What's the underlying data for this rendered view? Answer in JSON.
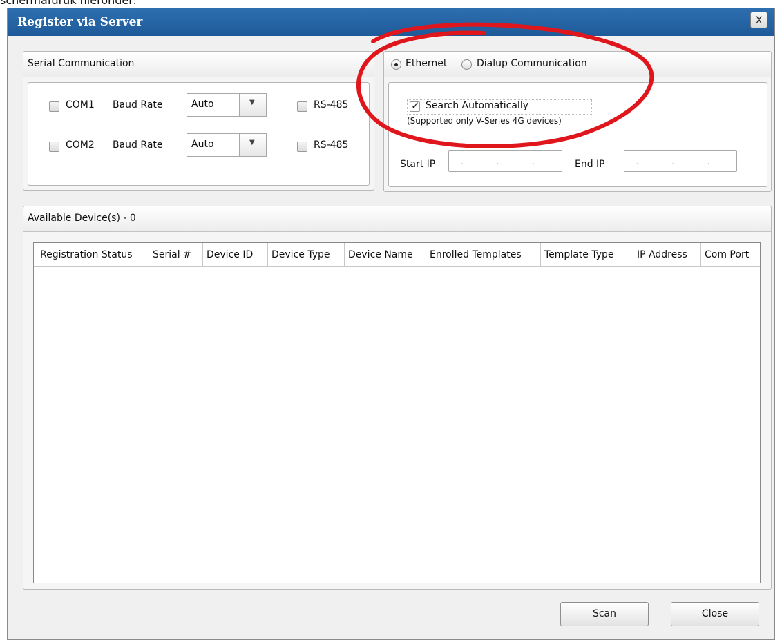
{
  "caption": "schermafdruk hieronder:",
  "window": {
    "title": "Register via Server",
    "close_label": "X"
  },
  "serial": {
    "header": "Serial Communication",
    "rows": [
      {
        "port": "COM1",
        "baud_label": "Baud Rate",
        "baud_value": "Auto",
        "rs485_label": "RS-485",
        "checked": false
      },
      {
        "port": "COM2",
        "baud_label": "Baud Rate",
        "baud_value": "Auto",
        "rs485_label": "RS-485",
        "checked": false
      }
    ]
  },
  "network": {
    "ethernet_label": "Ethernet",
    "dialup_label": "Dialup Communication",
    "selected": "Ethernet",
    "search_auto_label": "Search Automatically",
    "search_auto_checked": true,
    "search_note": "(Supported only V-Series 4G devices)",
    "start_ip_label": "Start IP",
    "end_ip_label": "End IP",
    "start_ip_value": ". . .",
    "end_ip_value": ". . ."
  },
  "devices": {
    "header": "Available Device(s) - 0",
    "columns": [
      "Registration Status",
      "Serial #",
      "Device ID",
      "Device Type",
      "Device Name",
      "Enrolled Templates",
      "Template Type",
      "IP Address",
      "Com Port"
    ],
    "rows": []
  },
  "actions": {
    "scan_label": "Scan",
    "close_label": "Close"
  },
  "colors": {
    "titlebar": "#1e5a99",
    "highlight": "#e0161d"
  }
}
